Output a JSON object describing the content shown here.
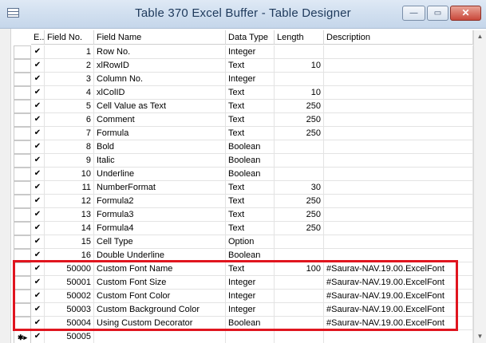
{
  "window": {
    "title": "Table 370 Excel Buffer - Table Designer",
    "buttons": {
      "minimize": "—",
      "maximize": "▭",
      "close": "✕"
    }
  },
  "grid": {
    "headers": {
      "enabled": "E..",
      "field_no": "Field No.",
      "field_name": "Field Name",
      "data_type": "Data Type",
      "length": "Length",
      "description": "Description"
    },
    "check_glyph": "✔",
    "new_row_marker": "✱▸",
    "rows": [
      {
        "no": "1",
        "name": "Row No.",
        "type": "Integer",
        "length": "",
        "desc": ""
      },
      {
        "no": "2",
        "name": "xlRowID",
        "type": "Text",
        "length": "10",
        "desc": ""
      },
      {
        "no": "3",
        "name": "Column No.",
        "type": "Integer",
        "length": "",
        "desc": ""
      },
      {
        "no": "4",
        "name": "xlColID",
        "type": "Text",
        "length": "10",
        "desc": ""
      },
      {
        "no": "5",
        "name": "Cell Value as Text",
        "type": "Text",
        "length": "250",
        "desc": ""
      },
      {
        "no": "6",
        "name": "Comment",
        "type": "Text",
        "length": "250",
        "desc": ""
      },
      {
        "no": "7",
        "name": "Formula",
        "type": "Text",
        "length": "250",
        "desc": ""
      },
      {
        "no": "8",
        "name": "Bold",
        "type": "Boolean",
        "length": "",
        "desc": ""
      },
      {
        "no": "9",
        "name": "Italic",
        "type": "Boolean",
        "length": "",
        "desc": ""
      },
      {
        "no": "10",
        "name": "Underline",
        "type": "Boolean",
        "length": "",
        "desc": ""
      },
      {
        "no": "11",
        "name": "NumberFormat",
        "type": "Text",
        "length": "30",
        "desc": ""
      },
      {
        "no": "12",
        "name": "Formula2",
        "type": "Text",
        "length": "250",
        "desc": ""
      },
      {
        "no": "13",
        "name": "Formula3",
        "type": "Text",
        "length": "250",
        "desc": ""
      },
      {
        "no": "14",
        "name": "Formula4",
        "type": "Text",
        "length": "250",
        "desc": ""
      },
      {
        "no": "15",
        "name": "Cell Type",
        "type": "Option",
        "length": "",
        "desc": ""
      },
      {
        "no": "16",
        "name": "Double Underline",
        "type": "Boolean",
        "length": "",
        "desc": ""
      },
      {
        "no": "50000",
        "name": "Custom Font Name",
        "type": "Text",
        "length": "100",
        "desc": "#Saurav-NAV.19.00.ExcelFont"
      },
      {
        "no": "50001",
        "name": "Custom Font Size",
        "type": "Integer",
        "length": "",
        "desc": "#Saurav-NAV.19.00.ExcelFont"
      },
      {
        "no": "50002",
        "name": "Custom Font Color",
        "type": "Integer",
        "length": "",
        "desc": "#Saurav-NAV.19.00.ExcelFont"
      },
      {
        "no": "50003",
        "name": "Custom Background Color",
        "type": "Integer",
        "length": "",
        "desc": "#Saurav-NAV.19.00.ExcelFont"
      },
      {
        "no": "50004",
        "name": "Using Custom Decorator",
        "type": "Boolean",
        "length": "",
        "desc": "#Saurav-NAV.19.00.ExcelFont"
      }
    ],
    "new_row": {
      "no": "50005"
    }
  },
  "colors": {
    "highlight": "#e0151f",
    "title_text": "#1e395b"
  }
}
